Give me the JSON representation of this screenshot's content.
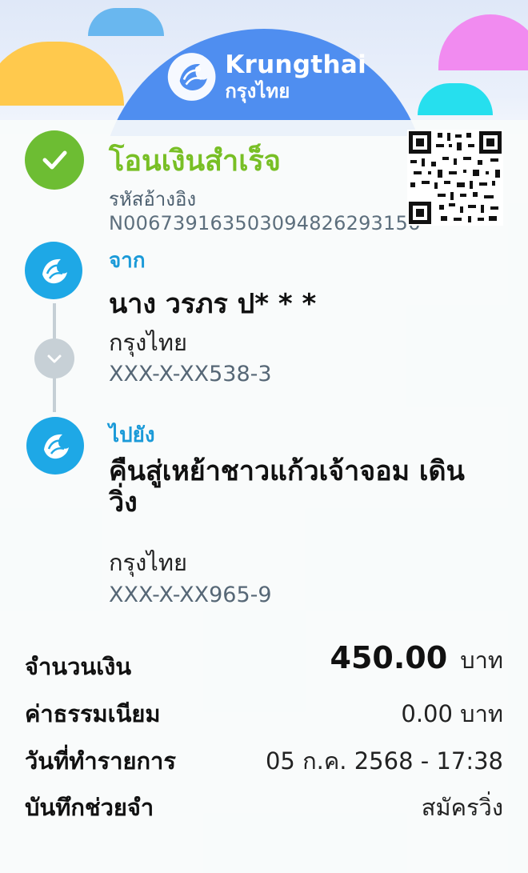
{
  "header": {
    "logo_en": "Krungthai",
    "logo_th": "กรุงไทย",
    "brand_color": "#4f8ef0"
  },
  "status": {
    "title": "โอนเงินสำเร็จ",
    "reference_label": "รหัสอ้างอิง",
    "reference_value": "N006739163503094826293156",
    "success_color": "#78bf25"
  },
  "from": {
    "label": "จาก",
    "name": "นาง วรภร ป* * *",
    "bank": "กรุงไทย",
    "account": "XXX-X-XX538-3"
  },
  "to": {
    "label": "ไปยัง",
    "name": "คืนสู่เหย้าชาวแก้วเจ้าจอม เดินวิ่ง",
    "bank": "กรุงไทย",
    "account": "XXX-X-XX965-9"
  },
  "details": {
    "amount_label": "จำนวนเงิน",
    "amount_value": "450.00",
    "amount_unit": "บาท",
    "fee_label": "ค่าธรรมเนียม",
    "fee_value": "0.00 บาท",
    "date_label": "วันที่ทำรายการ",
    "date_value": "05 ก.ค. 2568 - 17:38",
    "memo_label": "บันทึกช่วยจำ",
    "memo_value": "สมัครวิ่ง"
  },
  "icons": {
    "success": "check-icon",
    "from_avatar": "krungthai-bird-icon",
    "to_avatar": "krungthai-bird-icon",
    "qr": "qr-code-icon",
    "arrow": "chevron-down-icon"
  }
}
